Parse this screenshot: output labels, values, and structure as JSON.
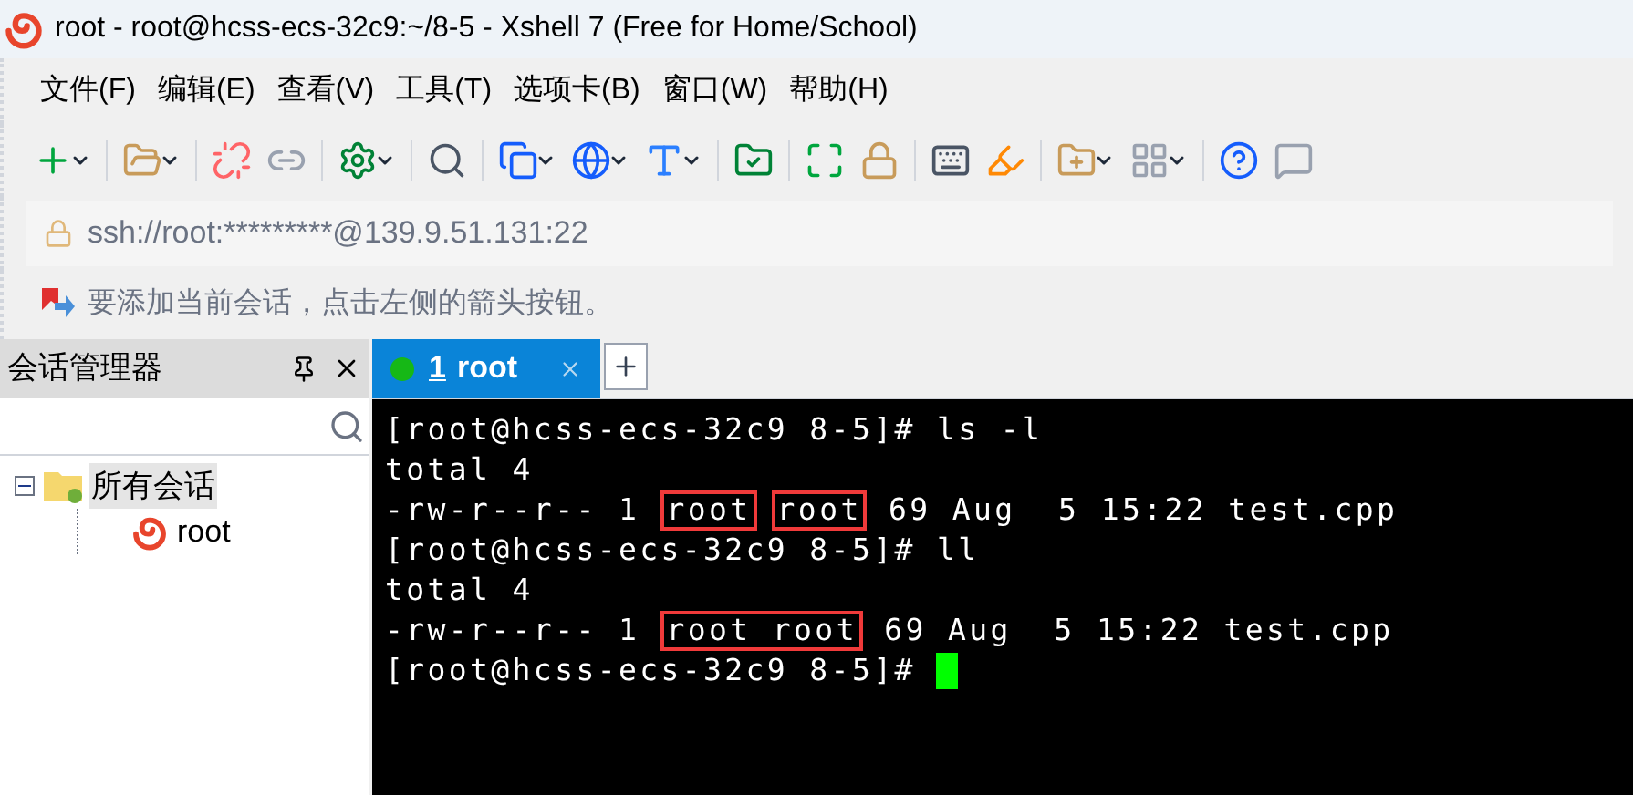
{
  "window": {
    "title": "root - root@hcss-ecs-32c9:~/8-5 - Xshell 7 (Free for Home/School)"
  },
  "menu": [
    "文件(F)",
    "编辑(E)",
    "查看(V)",
    "工具(T)",
    "选项卡(B)",
    "窗口(W)",
    "帮助(H)"
  ],
  "address_bar": {
    "value": "ssh://root:*********@139.9.51.131:22"
  },
  "hint_bar": {
    "text": "要添加当前会话，点击左侧的箭头按钮。"
  },
  "session_manager": {
    "title": "会话管理器",
    "tree": [
      {
        "label": "所有会话",
        "expanded": true,
        "selected": true,
        "children": [
          {
            "label": "root",
            "selected": false
          }
        ]
      }
    ]
  },
  "tabs": [
    {
      "number": "1",
      "label": "root",
      "selected": true,
      "connected": true
    }
  ],
  "terminal": {
    "lines": [
      [
        {
          "text": "[root@hcss-ecs-32c9 8-5]# ls -l",
          "boxed": false
        }
      ],
      [
        {
          "text": "total 4",
          "boxed": false
        }
      ],
      [
        {
          "text": "-rw-r--r-- 1 ",
          "boxed": false
        },
        {
          "text": "root",
          "boxed": true
        },
        {
          "text": "root",
          "boxed": true
        },
        {
          "text": " 69 Aug  5 15:22 test.cpp",
          "boxed": false
        }
      ],
      [
        {
          "text": "[root@hcss-ecs-32c9 8-5]# ll",
          "boxed": false
        }
      ],
      [
        {
          "text": "total 4",
          "boxed": false
        }
      ],
      [
        {
          "text": "-rw-r--r-- 1 ",
          "boxed": false
        },
        {
          "text": "root root",
          "boxed": true
        },
        {
          "text": " 69 Aug  5 15:22 test.cpp",
          "boxed": false
        }
      ],
      [
        {
          "text": "[root@hcss-ecs-32c9 8-5]# ",
          "boxed": false
        }
      ]
    ],
    "cursor": true
  }
}
